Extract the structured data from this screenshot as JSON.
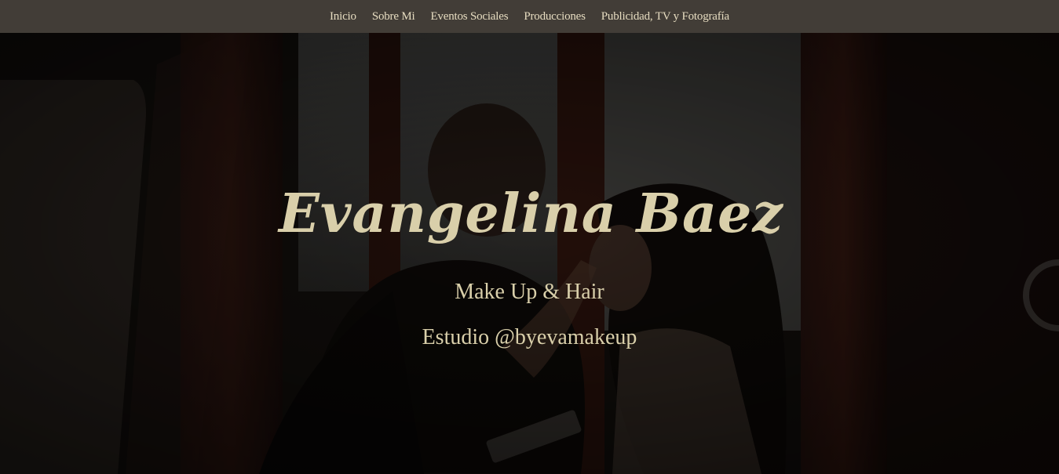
{
  "nav": {
    "items": [
      {
        "label": "Inicio"
      },
      {
        "label": "Sobre Mi"
      },
      {
        "label": "Eventos Sociales"
      },
      {
        "label": "Producciones"
      },
      {
        "label": "Publicidad, TV y Fotografía"
      }
    ]
  },
  "hero": {
    "title": "Evangelina Baez",
    "subtitle": "Make Up & Hair",
    "studio": "Estudio @byevamakeup"
  },
  "colors": {
    "nav_bg": "#423d37",
    "nav_text": "#e6dcc0",
    "hero_text": "#d9cfaa",
    "hero_overlay": "#100e0c"
  }
}
